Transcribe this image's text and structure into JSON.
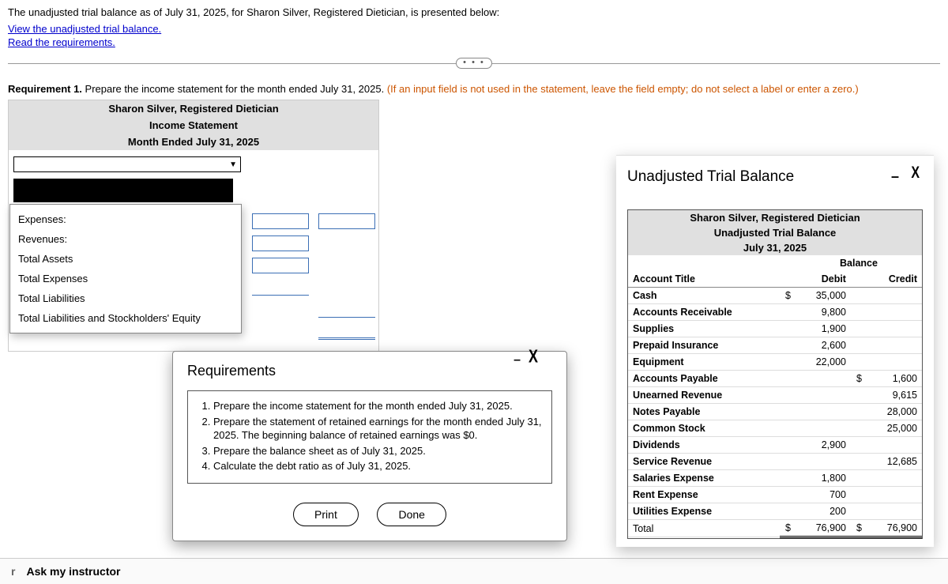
{
  "intro": {
    "line1": "The unadjusted trial balance as of July 31, 2025, for Sharon Silver, Registered Dietician, is presented below:",
    "link1": "View the unadjusted trial balance.",
    "link2": "Read the requirements."
  },
  "expander_label": "• • •",
  "requirement_line": {
    "prefix": "Requirement 1.",
    "body": " Prepare the income statement for the month ended July 31, 2025. ",
    "orange": "(If an input field is not used in the statement, leave the field empty; do not select a label or enter a zero.)"
  },
  "statement": {
    "h1": "Sharon Silver, Registered Dietician",
    "h2": "Income Statement",
    "h3": "Month Ended July 31, 2025"
  },
  "dropdown_arrow": "▼",
  "dropdown_options": [
    "Expenses:",
    "Revenues:",
    "Total Assets",
    "Total Expenses",
    "Total Liabilities",
    "Total Liabilities and Stockholders' Equity"
  ],
  "req_modal": {
    "title": "Requirements",
    "items": [
      "Prepare the income statement for the month ended July 31, 2025.",
      "Prepare the statement of retained earnings for the month ended July 31, 2025. The beginning balance of retained earnings was $0.",
      "Prepare the balance sheet as of July 31, 2025.",
      "Calculate the debt ratio as of July 31, 2025."
    ],
    "print": "Print",
    "done": "Done"
  },
  "tb": {
    "title": "Unadjusted Trial Balance",
    "h1": "Sharon Silver, Registered Dietician",
    "h2": "Unadjusted Trial Balance",
    "h3": "July 31, 2025",
    "balance_label": "Balance",
    "col_account": "Account Title",
    "col_debit": "Debit",
    "col_credit": "Credit",
    "rows": [
      {
        "name": "Cash",
        "dsym": "$",
        "debit": "35,000",
        "csym": "",
        "credit": ""
      },
      {
        "name": "Accounts Receivable",
        "dsym": "",
        "debit": "9,800",
        "csym": "",
        "credit": ""
      },
      {
        "name": "Supplies",
        "dsym": "",
        "debit": "1,900",
        "csym": "",
        "credit": ""
      },
      {
        "name": "Prepaid Insurance",
        "dsym": "",
        "debit": "2,600",
        "csym": "",
        "credit": ""
      },
      {
        "name": "Equipment",
        "dsym": "",
        "debit": "22,000",
        "csym": "",
        "credit": ""
      },
      {
        "name": "Accounts Payable",
        "dsym": "",
        "debit": "",
        "csym": "$",
        "credit": "1,600"
      },
      {
        "name": "Unearned Revenue",
        "dsym": "",
        "debit": "",
        "csym": "",
        "credit": "9,615"
      },
      {
        "name": "Notes Payable",
        "dsym": "",
        "debit": "",
        "csym": "",
        "credit": "28,000"
      },
      {
        "name": "Common Stock",
        "dsym": "",
        "debit": "",
        "csym": "",
        "credit": "25,000"
      },
      {
        "name": "Dividends",
        "dsym": "",
        "debit": "2,900",
        "csym": "",
        "credit": ""
      },
      {
        "name": "Service Revenue",
        "dsym": "",
        "debit": "",
        "csym": "",
        "credit": "12,685"
      },
      {
        "name": "Salaries Expense",
        "dsym": "",
        "debit": "1,800",
        "csym": "",
        "credit": ""
      },
      {
        "name": "Rent Expense",
        "dsym": "",
        "debit": "700",
        "csym": "",
        "credit": ""
      },
      {
        "name": "Utilities Expense",
        "dsym": "",
        "debit": "200",
        "csym": "",
        "credit": ""
      }
    ],
    "total_label": "Total",
    "total_dsym": "$",
    "total_debit": "76,900",
    "total_csym": "$",
    "total_credit": "76,900"
  },
  "footer": {
    "r": "r",
    "ask": "Ask my instructor"
  },
  "icons": {
    "close": "X",
    "minimize": "–"
  }
}
